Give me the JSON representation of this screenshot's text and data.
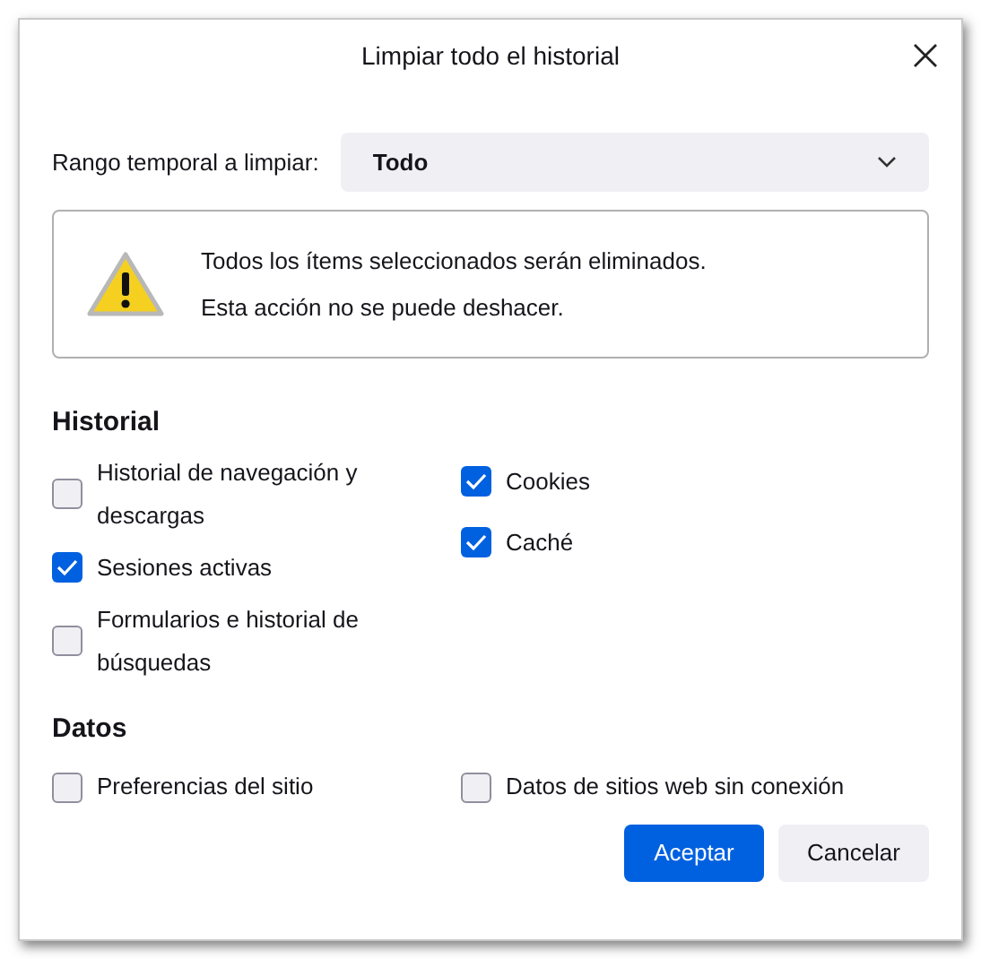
{
  "window": {
    "title": "Limpiar todo el historial"
  },
  "range": {
    "label": "Rango temporal a limpiar:",
    "value": "Todo"
  },
  "warning": {
    "lines": [
      "Todos los ítems seleccionados serán eliminados.",
      "Esta acción no se puede deshacer."
    ]
  },
  "sections": [
    {
      "title": "Historial",
      "columns": [
        [
          {
            "label": "Historial de navegación y descargas",
            "checked": false
          },
          {
            "label": "Sesiones activas",
            "checked": true
          },
          {
            "label": "Formularios e historial de búsquedas",
            "checked": false
          }
        ],
        [
          {
            "label": "Cookies",
            "checked": true
          },
          {
            "label": "Caché",
            "checked": true
          }
        ]
      ]
    },
    {
      "title": "Datos",
      "columns": [
        [
          {
            "label": "Preferencias del sitio",
            "checked": false
          }
        ],
        [
          {
            "label": "Datos de sitios web sin conexión",
            "checked": false
          }
        ]
      ]
    }
  ],
  "buttons": [
    {
      "label": "Aceptar",
      "kind": "primary"
    },
    {
      "label": "Cancelar",
      "kind": "secondary"
    }
  ]
}
